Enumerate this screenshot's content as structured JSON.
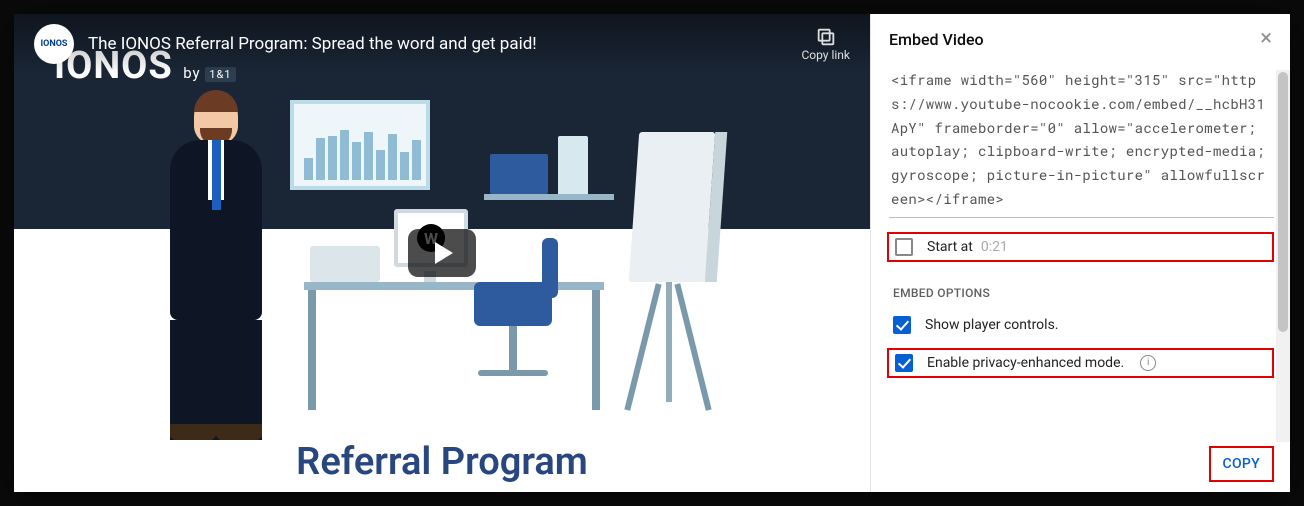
{
  "video": {
    "title": "The IONOS Referral Program: Spread the word and get paid!",
    "channel_avatar_text": "IONOS",
    "copy_link_label": "Copy link",
    "brand_text": "IONOS",
    "brand_by": "by",
    "brand_sub": "1&1",
    "footer_title": "Referral Program"
  },
  "panel": {
    "title": "Embed Video",
    "code": "<iframe width=\"560\" height=\"315\" src=\"https://www.youtube-nocookie.com/embed/__hcbH31ApY\" frameborder=\"0\" allow=\"accelerometer; autoplay; clipboard-write; encrypted-media; gyroscope; picture-in-picture\" allowfullscreen></iframe>",
    "start_at_label": "Start at",
    "start_at_value": "0:21",
    "start_at_checked": false,
    "section_label": "EMBED OPTIONS",
    "option_controls": "Show player controls.",
    "option_controls_checked": true,
    "option_privacy": "Enable privacy-enhanced mode.",
    "option_privacy_checked": true,
    "copy_button": "COPY"
  }
}
